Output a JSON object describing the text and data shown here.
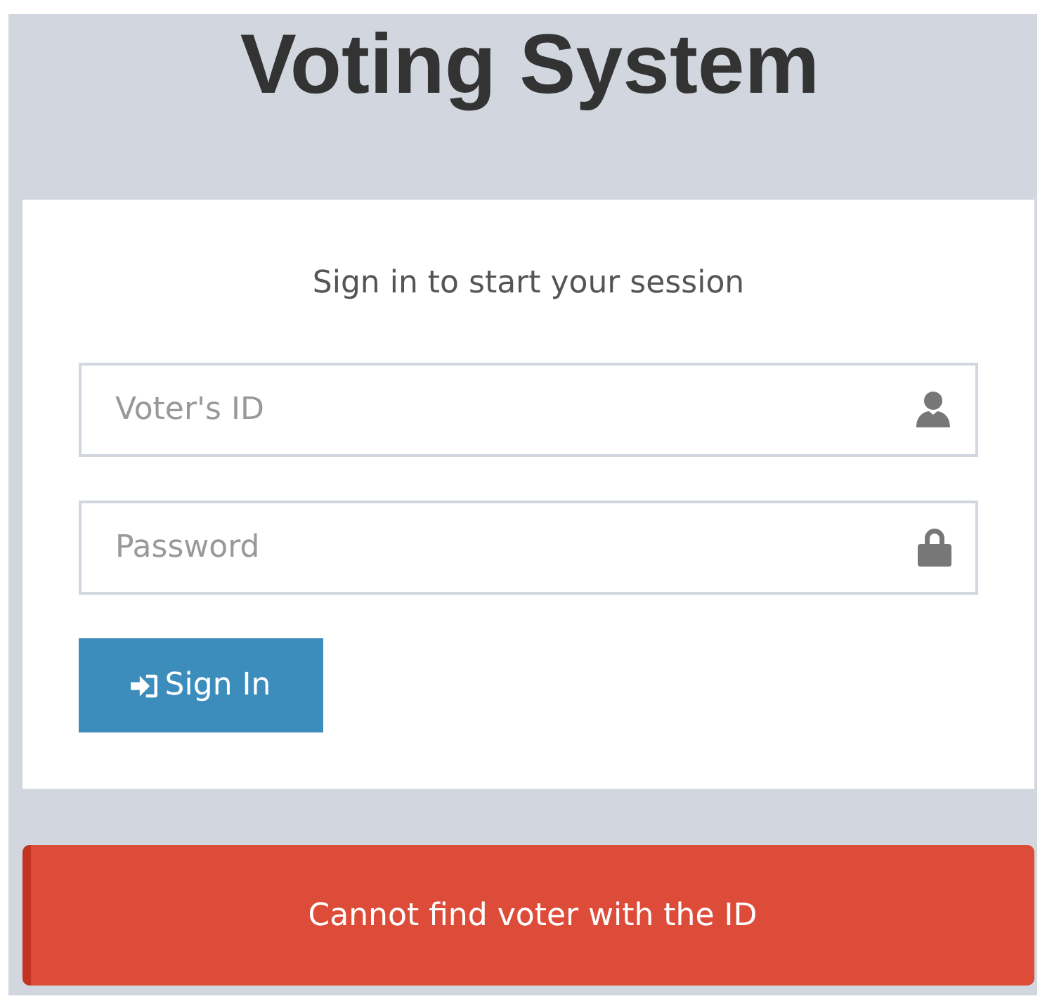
{
  "title": "Voting System",
  "login_box": {
    "subtitle": "Sign in to start your session",
    "fields": [
      {
        "kind": "user",
        "placeholder": "Voter's ID"
      },
      {
        "kind": "password",
        "placeholder": "Password"
      }
    ],
    "button": {
      "label": "Sign In"
    }
  },
  "alert": {
    "kind": "error",
    "message": "Cannot find voter with the ID"
  }
}
